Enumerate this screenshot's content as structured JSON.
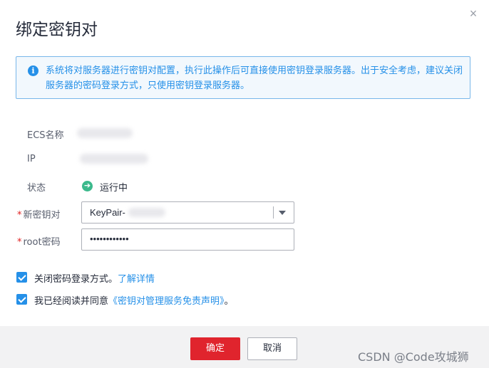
{
  "dialog": {
    "title": "绑定密钥对",
    "close_glyph": "×"
  },
  "info": {
    "icon": "info-icon",
    "icon_glyph": "i",
    "text": "系统将对服务器进行密钥对配置，执行此操作后可直接使用密钥登录服务器。出于安全考虑，建议关闭服务器的密码登录方式，只使用密钥登录服务器。"
  },
  "form": {
    "ecs_name_label": "ECS名称",
    "ip_label": "IP",
    "status_label": "状态",
    "status_icon": "running-arrow-icon",
    "status_icon_glyph": "➔",
    "status_value": "运行中",
    "keypair_label": "新密钥对",
    "keypair_value": "KeyPair-",
    "root_pw_label": "root密码",
    "root_pw_value": "••••••••••••",
    "required_mark": "*"
  },
  "options": {
    "disable_pw_text": "关闭密码登录方式。",
    "disable_pw_link": "了解详情",
    "agree_text": "我已经阅读并同意",
    "agree_link": "《密钥对管理服务免责声明》",
    "agree_suffix": "。"
  },
  "footer": {
    "confirm": "确定",
    "cancel": "取消"
  },
  "watermark": "CSDN @Code攻城狮",
  "colors": {
    "accent": "#2590e8",
    "primary_button": "#e0242d",
    "status_ok": "#3bb98c"
  }
}
